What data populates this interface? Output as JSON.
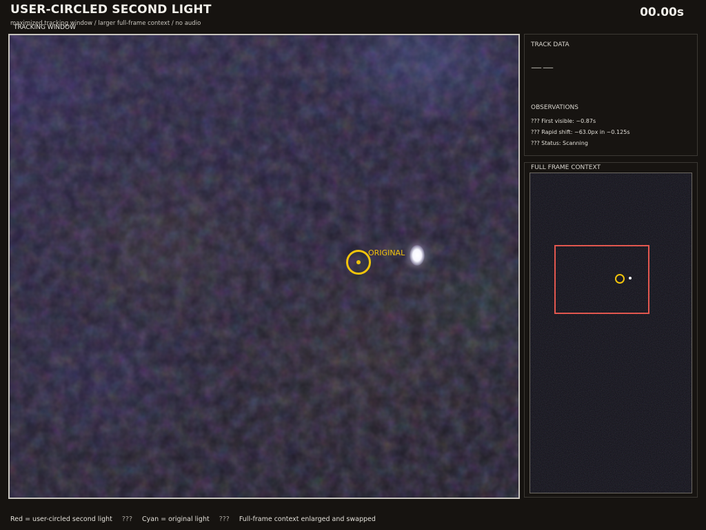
{
  "header": {
    "title": "USER-CIRCLED SECOND LIGHT",
    "subtitle": "maximized tracking window / larger full-frame context / no audio",
    "timer": "00.00s"
  },
  "main_view": {
    "label": "TRACKING WINDOW",
    "original_label": "ORIGINAL"
  },
  "track_data": {
    "title": "TRACK DATA",
    "value": "——"
  },
  "observations": {
    "title": "OBSERVATIONS",
    "items": [
      "??? First visible: ~0.87s",
      "??? Rapid shift: ~63.0px in ~0.125s",
      "??? Status: Scanning"
    ]
  },
  "context": {
    "title": "FULL FRAME CONTEXT"
  },
  "legend": {
    "items": [
      "Red = user-circled second light",
      "Cyan = original light",
      "Full-frame context enlarged and swapped"
    ],
    "separator": "???"
  },
  "colors": {
    "ring": "#f2c40b",
    "context_box": "#e2574f",
    "background": "#161310"
  }
}
